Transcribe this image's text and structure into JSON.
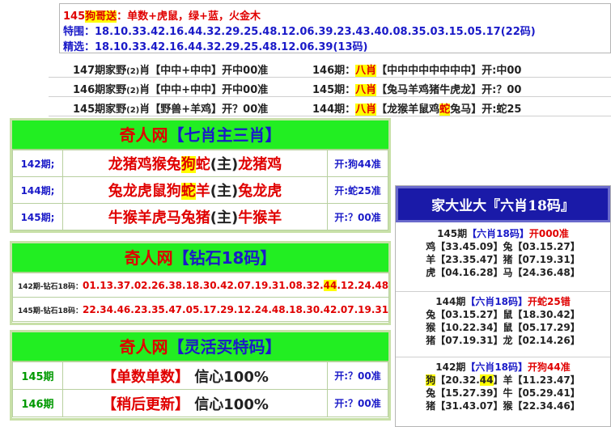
{
  "info": {
    "head_prefix": "145",
    "head_hl": "狗哥送",
    "head_text": "：单数+虎鼠，绿+蓝，火金木",
    "line2_label": "特围：",
    "line2_value": "18.10.33.42.16.44.32.29.25.48.12.06.39.23.43.40.08.35.03.15.05.17(22码)",
    "line3_label": "精选：",
    "line3_value": "18.10.33.42.16.44.32.29.25.48.12.06.39(13码)"
  },
  "rows": [
    {
      "left_a": "147期家野",
      "left_n": "(2)",
      "left_b": "肖【中中+中中】开中00准",
      "right_a": "146期：",
      "right_hl": "八肖",
      "right_b": "【中中中中中中中中】开:中00"
    },
    {
      "left_a": "146期家野",
      "left_n": "(2)",
      "left_b": "肖【中中+中中】开中00准",
      "right_a": "145期：",
      "right_hl": "八肖",
      "right_b": "【兔马羊鸡猪牛虎龙】开:？00"
    },
    {
      "left_a": "145期家野",
      "left_n": "(2)",
      "left_b": "肖【野兽+羊鸡】开？00准",
      "right_a": "144期：",
      "right_hl": "八肖",
      "right_b1": "【龙猴羊鼠鸡",
      "right_hl2": "蛇",
      "right_b2": "兔马】开:蛇25"
    }
  ],
  "panel1": {
    "title_a": "奇人网",
    "title_b": "【七肖主三肖】",
    "rows": [
      {
        "label": "142期;",
        "a": "龙猪鸡猴兔",
        "hl": "狗",
        "b": "蛇",
        "zhu": "(主)",
        "c": "龙猪鸡",
        "res": "开:狗44准"
      },
      {
        "label": "144期;",
        "a": "兔龙虎鼠狗",
        "hl": "蛇",
        "b": "羊",
        "zhu": "(主)",
        "c": "兔龙虎",
        "res": "开:蛇25准"
      },
      {
        "label": "145期;",
        "a": "牛猴羊虎马兔猪",
        "hl": "",
        "b": "",
        "zhu": "(主)",
        "c": "牛猴羊",
        "res": "开:？00准"
      }
    ]
  },
  "panel2": {
    "title_a": "奇人网",
    "title_b": "【钻石18码】",
    "row1_label": "142期-钻石18码：",
    "row1_a": "01.13.37.02.26.38.18.30.42.07.19.31.08.32.",
    "row1_hl": "44",
    "row1_b": ".12.24.48",
    "row2_label": "145期-钻石18码：",
    "row2_value": "22.34.46.23.35.47.05.17.29.12.24.48.18.30.42.07.19.31"
  },
  "panel3": {
    "title_a": "奇人网",
    "title_b": "【灵活买特码】",
    "rows": [
      {
        "label": "145期",
        "main": "【单数单数】",
        "conf": "信心100%",
        "res": "开:？00准"
      },
      {
        "label": "146期",
        "main": "【稍后更新】",
        "conf": "信心100%",
        "res": "开:？00准"
      }
    ]
  },
  "right": {
    "title": "家大业大『六肖18码』",
    "sections": [
      {
        "head_a": "145期",
        "head_b": "【六肖18码】",
        "head_c": "开000准",
        "items": [
          {
            "a": "鸡",
            "ahl": false,
            "av": "【33.45.09】",
            "b": "兔",
            "bv": "【03.15.27】"
          },
          {
            "a": "羊",
            "ahl": false,
            "av": "【23.35.47】",
            "b": "猪",
            "bv": "【07.19.31】"
          },
          {
            "a": "虎",
            "ahl": false,
            "av": "【04.16.28】",
            "b": "马",
            "bv": "【24.36.48】"
          }
        ]
      },
      {
        "head_a": "144期",
        "head_b": "【六肖18码】",
        "head_c": "开蛇25错",
        "items": [
          {
            "a": "兔",
            "ahl": false,
            "av": "【03.15.27】",
            "b": "鼠",
            "bv": "【18.30.42】"
          },
          {
            "a": "猴",
            "ahl": false,
            "av": "【10.22.34】",
            "b": "鼠",
            "bv": "【05.17.29】"
          },
          {
            "a": "猪",
            "ahl": false,
            "av": "【07.19.31】",
            "b": "龙",
            "bv": "【02.14.26】"
          }
        ]
      },
      {
        "head_a": "142期",
        "head_b": "【六肖18码】",
        "head_c": "开狗44准",
        "items": [
          {
            "a": "狗",
            "ahl": true,
            "av1": "【20.32.",
            "avhl": "44",
            "av2": "】",
            "b": "羊",
            "bv": "【11.23.47】"
          },
          {
            "a": "兔",
            "ahl": false,
            "av": "【15.27.39】",
            "b": "牛",
            "bv": "【05.29.41】"
          },
          {
            "a": "猪",
            "ahl": false,
            "av": "【31.43.07】",
            "b": "猴",
            "bv": "【22.34.46】"
          }
        ]
      }
    ]
  }
}
